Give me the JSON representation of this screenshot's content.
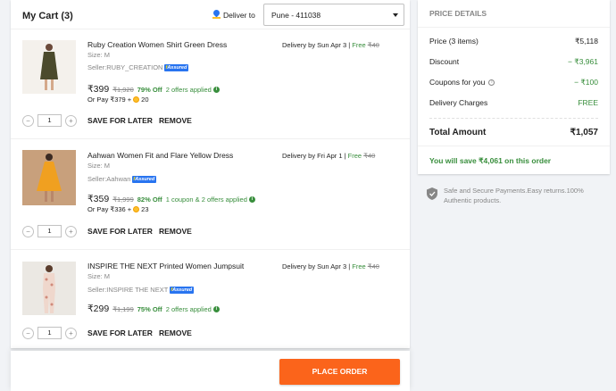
{
  "cart": {
    "title": "My Cart (3)",
    "deliver_label": "Deliver to",
    "pincode": "Pune - 411038"
  },
  "items": [
    {
      "name": "Ruby Creation Women Shirt Green Dress",
      "size": "Size: M",
      "seller": "Seller:RUBY_CREATION",
      "price": "₹399",
      "mrp": "₹1,920",
      "off": "79% Off",
      "offers": "2 offers applied",
      "or_pay": "Or Pay ₹379 +",
      "coins": "20",
      "delivery": "Delivery by Sun Apr 3",
      "free": "Free",
      "old_charge": "₹40",
      "qty": "1"
    },
    {
      "name": "Aahwan Women Fit and Flare Yellow Dress",
      "size": "Size: M",
      "seller": "Seller:Aahwan",
      "price": "₹359",
      "mrp": "₹1,999",
      "off": "82% Off",
      "offers": "1 coupon & 2 offers applied",
      "or_pay": "Or Pay ₹336 +",
      "coins": "23",
      "delivery": "Delivery by Fri Apr 1",
      "free": "Free",
      "old_charge": "₹40",
      "qty": "1"
    },
    {
      "name": "INSPIRE THE NEXT Printed Women Jumpsuit",
      "size": "Size: M",
      "seller": "Seller:INSPIRE THE NEXT",
      "price": "₹299",
      "mrp": "₹1,199",
      "off": "75% Off",
      "offers": "2 offers applied",
      "delivery": "Delivery by Sun Apr 3",
      "free": "Free",
      "old_charge": "₹40",
      "qty": "1"
    }
  ],
  "actions": {
    "save_for_later": "SAVE FOR LATER",
    "remove": "REMOVE",
    "minus": "−",
    "plus": "+",
    "separator": " | "
  },
  "assured_badge": {
    "prefix": "f",
    "text": "Assured"
  },
  "footer": {
    "place_order": "PLACE ORDER"
  },
  "price_details": {
    "title": "PRICE DETAILS",
    "price_label": "Price (3 items)",
    "price_value": "₹5,118",
    "discount_label": "Discount",
    "discount_value": "− ₹3,961",
    "coupons_label": "Coupons for you",
    "coupons_value": "− ₹100",
    "delivery_label": "Delivery Charges",
    "delivery_value": "FREE",
    "total_label": "Total Amount",
    "total_value": "₹1,057",
    "savings": "You will save ₹4,061 on this order"
  },
  "safe_text": "Safe and Secure Payments.Easy returns.100% Authentic products.",
  "colors": {
    "accent": "#2874f0",
    "order_button": "#fb641b",
    "green": "#388e3c"
  }
}
